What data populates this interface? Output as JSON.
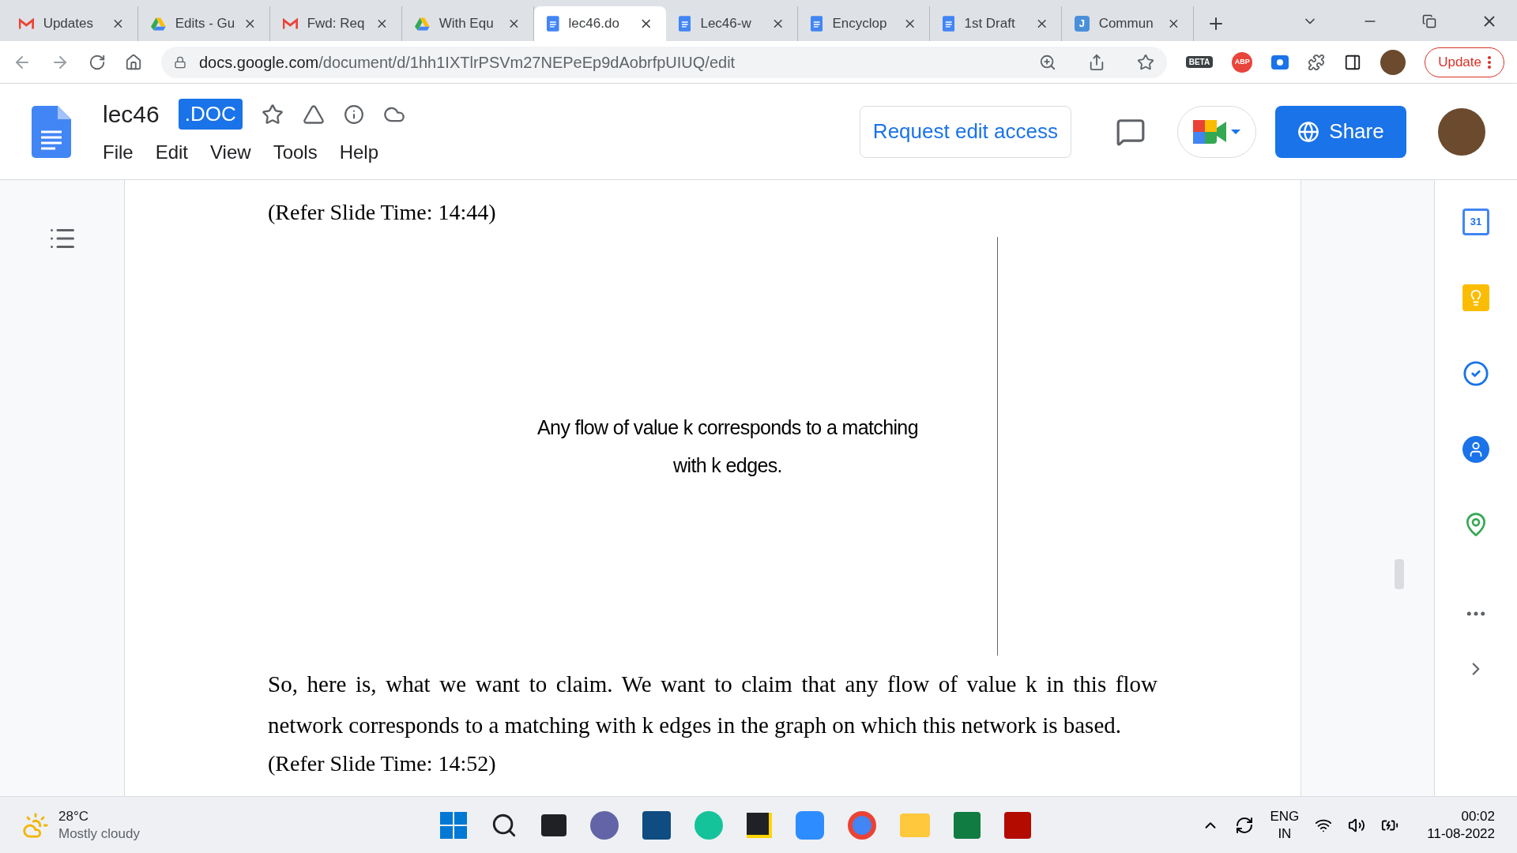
{
  "browser": {
    "tabs": [
      {
        "title": "Updates",
        "kind": "mail",
        "selected": false
      },
      {
        "title": "Edits - Gu",
        "kind": "drive",
        "selected": false
      },
      {
        "title": "Fwd: Req",
        "kind": "mail",
        "selected": false
      },
      {
        "title": "With Equ",
        "kind": "drive",
        "selected": false
      },
      {
        "title": "lec46.do",
        "kind": "doc",
        "selected": true
      },
      {
        "title": "Lec46-w",
        "kind": "doc",
        "selected": false
      },
      {
        "title": "Encyclop",
        "kind": "doc",
        "selected": false
      },
      {
        "title": "1st Draft",
        "kind": "doc",
        "selected": false
      },
      {
        "title": "Commun",
        "kind": "letter",
        "selected": false
      }
    ],
    "tab_glyph": "J",
    "url_host": "docs.google.com",
    "url_path": "/document/d/1hh1IXTlrPSVm27NEPeEp9dAobrfpUIUQ/edit",
    "beta_label": "BETA",
    "abp_label": "ABP",
    "update_button": "Update"
  },
  "docs": {
    "doc_name": "lec46",
    "badge": ".DOC",
    "menu": [
      "File",
      "Edit",
      "View",
      "Tools",
      "Help"
    ],
    "request_button": "Request edit access",
    "share_button": "Share"
  },
  "document": {
    "caption": "(Refer Slide Time: 14:44)",
    "slide_text": "Any flow of value k corresponds to a matching with k edges.",
    "paragraph": "So, here is, what we want to claim. We want to claim that any flow of value k in this flow network corresponds to a matching with k edges in the graph on which this network is based.",
    "next_caption": "(Refer Slide Time: 14:52)"
  },
  "side_panel": {
    "calendar_day": "31"
  },
  "taskbar": {
    "temperature": "28°C",
    "weather": "Mostly cloudy",
    "lang": "ENG",
    "region": "IN",
    "time": "00:02",
    "date": "11-08-2022"
  }
}
